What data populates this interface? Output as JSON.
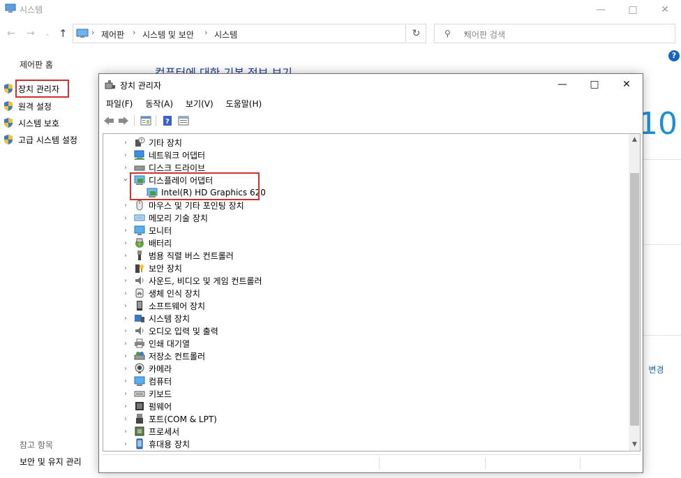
{
  "system_window": {
    "title": "시스템",
    "breadcrumb": [
      "제어판",
      "시스템 및 보안",
      "시스템"
    ],
    "search_placeholder": "제어판 검색",
    "control_panel_home": "제어판 홈",
    "left_links": [
      "장치 관리자",
      "원격 설정",
      "시스템 보호",
      "고급 시스템 설정"
    ],
    "see_also_title": "참고 항목",
    "see_also_link": "보안 및 유지 관리",
    "main_heading": "컴퓨터에 대한 기본 정보 보기",
    "windows_logo_fragment": "10",
    "change_link_fragment": "변경"
  },
  "device_manager": {
    "title": "장치 관리자",
    "menus": [
      "파일(F)",
      "동작(A)",
      "보기(V)",
      "도움말(H)"
    ],
    "tree": [
      {
        "label": "기타 장치",
        "icon": "other-devices-icon",
        "expanded": false
      },
      {
        "label": "네트워크 어댑터",
        "icon": "network-adapter-icon",
        "expanded": false
      },
      {
        "label": "디스크 드라이브",
        "icon": "disk-drive-icon",
        "expanded": false
      },
      {
        "label": "디스플레이 어댑터",
        "icon": "display-adapter-icon",
        "expanded": true,
        "children": [
          {
            "label": "Intel(R) HD Graphics 620",
            "icon": "display-adapter-icon"
          }
        ]
      },
      {
        "label": "마우스 및 기타 포인팅 장치",
        "icon": "mouse-icon",
        "expanded": false
      },
      {
        "label": "메모리 기술 장치",
        "icon": "memory-device-icon",
        "expanded": false
      },
      {
        "label": "모니터",
        "icon": "monitor-icon",
        "expanded": false
      },
      {
        "label": "배터리",
        "icon": "battery-icon",
        "expanded": false
      },
      {
        "label": "범용 직렬 버스 컨트롤러",
        "icon": "usb-icon",
        "expanded": false
      },
      {
        "label": "보안 장치",
        "icon": "security-device-icon",
        "expanded": false
      },
      {
        "label": "사운드, 비디오 및 게임 컨트롤러",
        "icon": "sound-icon",
        "expanded": false
      },
      {
        "label": "생체 인식 장치",
        "icon": "biometric-icon",
        "expanded": false
      },
      {
        "label": "소프트웨어 장치",
        "icon": "software-device-icon",
        "expanded": false
      },
      {
        "label": "시스템 장치",
        "icon": "system-device-icon",
        "expanded": false
      },
      {
        "label": "오디오 입력 및 출력",
        "icon": "audio-icon",
        "expanded": false
      },
      {
        "label": "인쇄 대기열",
        "icon": "printer-icon",
        "expanded": false
      },
      {
        "label": "저장소 컨트롤러",
        "icon": "storage-controller-icon",
        "expanded": false
      },
      {
        "label": "카메라",
        "icon": "camera-icon",
        "expanded": false
      },
      {
        "label": "컴퓨터",
        "icon": "computer-icon",
        "expanded": false
      },
      {
        "label": "키보드",
        "icon": "keyboard-icon",
        "expanded": false
      },
      {
        "label": "펌웨어",
        "icon": "firmware-icon",
        "expanded": false
      },
      {
        "label": "포트(COM & LPT)",
        "icon": "port-icon",
        "expanded": false
      },
      {
        "label": "프로세서",
        "icon": "processor-icon",
        "expanded": false
      },
      {
        "label": "휴대용 장치",
        "icon": "portable-device-icon",
        "expanded": false
      }
    ]
  },
  "colors": {
    "highlight": "#d32f2f",
    "heading_blue": "#1e3d8f",
    "win10_blue": "#1e90d0",
    "help_blue": "#1565c0"
  }
}
